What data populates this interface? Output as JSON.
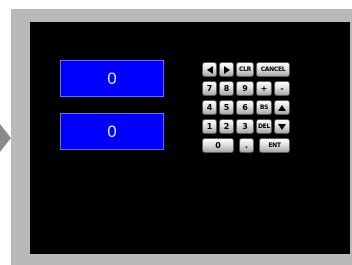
{
  "displays": {
    "value1": "0",
    "value2": "0"
  },
  "keypad": {
    "left_arrow": "left-arrow-icon",
    "right_arrow": "right-arrow-icon",
    "clr": "CLR",
    "cancel": "CANCEL",
    "k7": "7",
    "k8": "8",
    "k9": "9",
    "plus": "+",
    "minus": "-",
    "k4": "4",
    "k5": "5",
    "k6": "6",
    "bs": "BS",
    "up_arrow": "up-arrow-icon",
    "k1": "1",
    "k2": "2",
    "k3": "3",
    "del": "DEL",
    "down_arrow": "down-arrow-icon",
    "k0": "0",
    "dot": ".",
    "ent": "ENT"
  },
  "colors": {
    "display_bg": "#0000ff",
    "screen_bg": "#000000",
    "frame": "#b9b9b9"
  }
}
